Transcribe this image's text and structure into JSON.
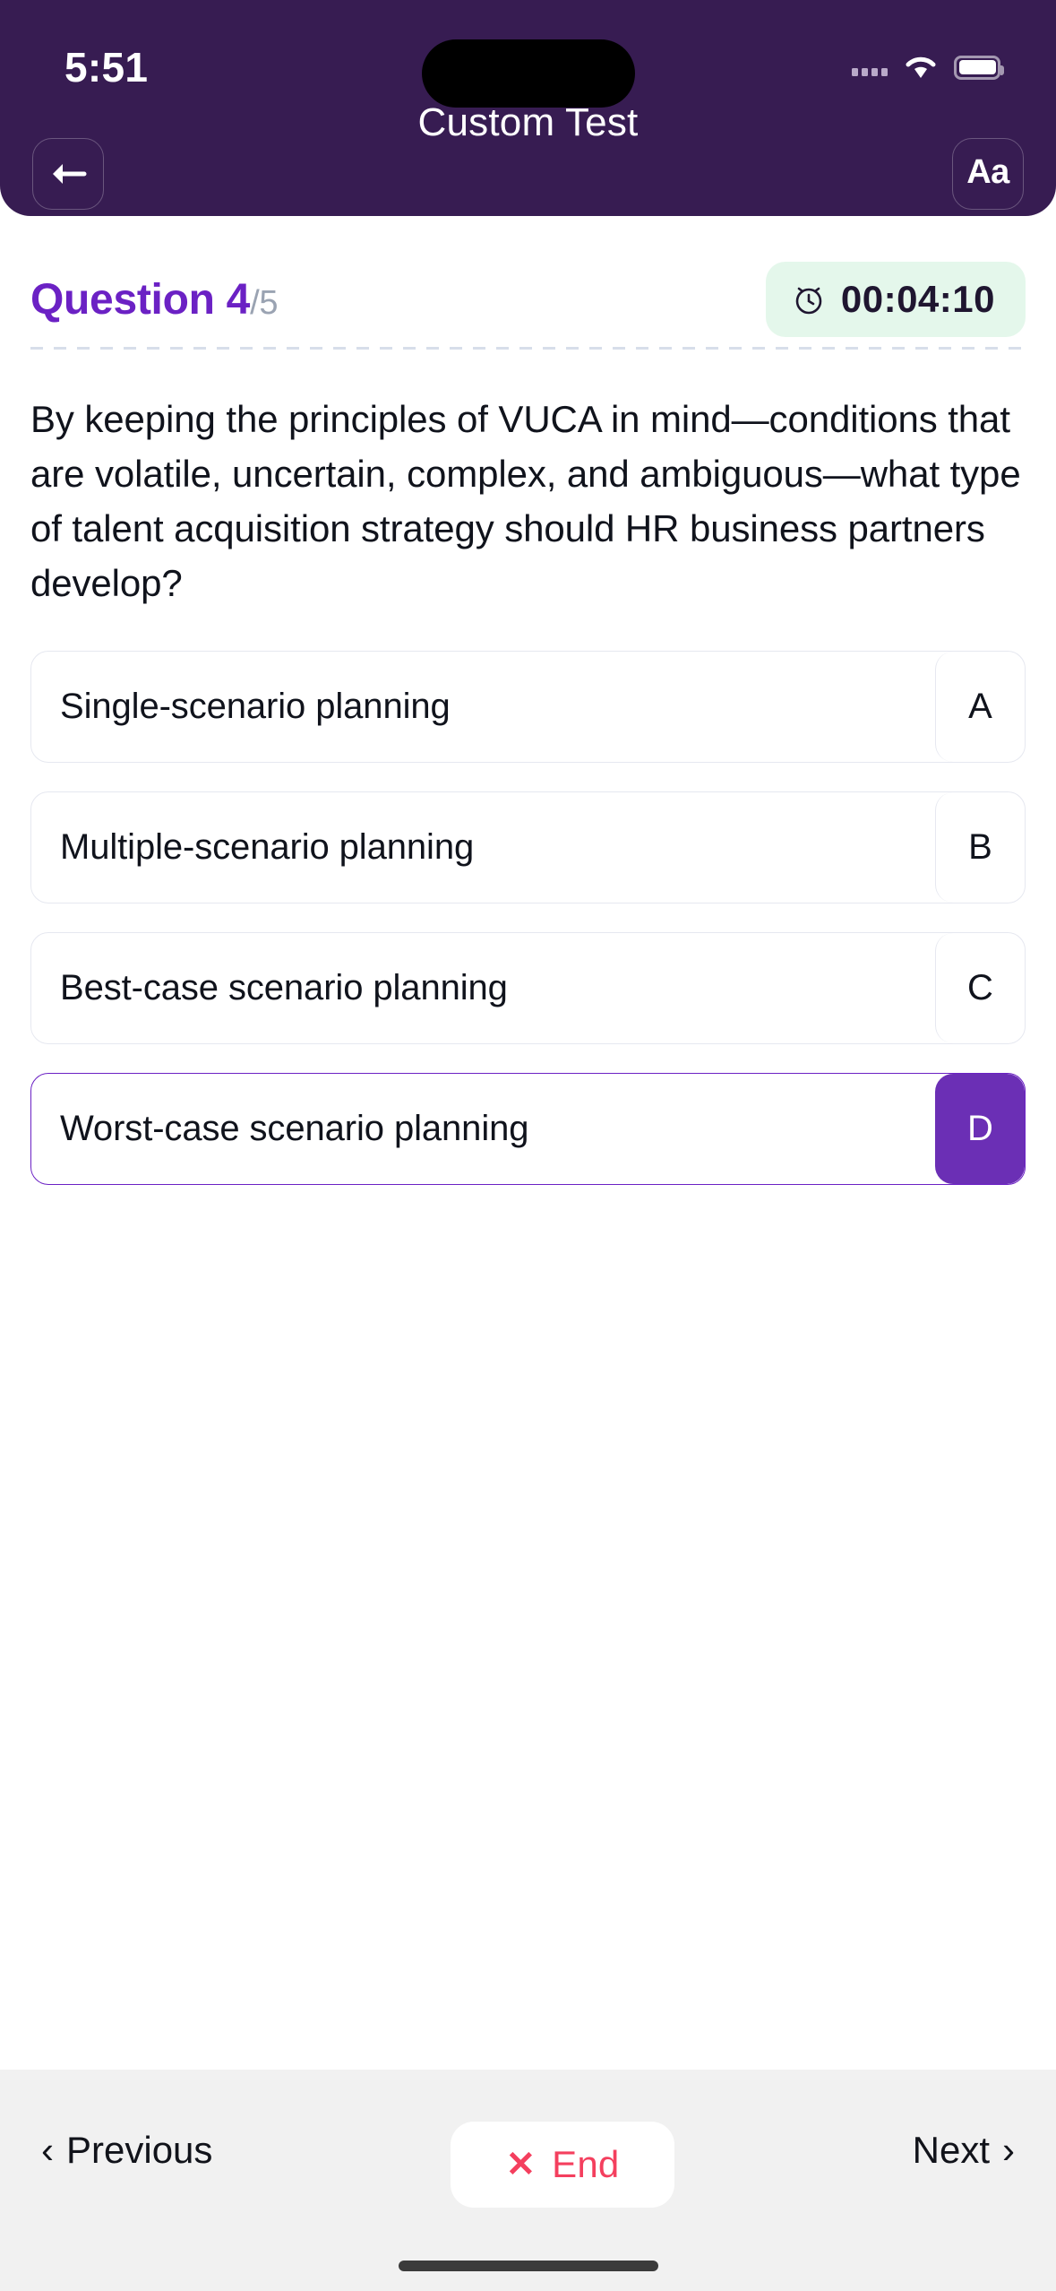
{
  "status_bar": {
    "time": "5:51",
    "signal_icon": "cellular-signal-icon",
    "wifi_icon": "wifi-icon",
    "battery_icon": "battery-icon"
  },
  "header": {
    "title": "Custom Test",
    "back_icon": "back-arrow-icon",
    "font_size_label": "Aa",
    "background_color": "#371C52"
  },
  "question_header": {
    "label": "Question ",
    "current": "4",
    "total": "/5",
    "accent_color": "#6B21C4",
    "timer": {
      "icon": "alarm-clock-icon",
      "value": "00:04:10",
      "background_color": "#E4F7EB"
    }
  },
  "question": {
    "text": "By keeping the principles of VUCA in mind—conditions that are volatile, uncertain, complex, and ambiguous—what type of talent acquisition strategy should HR business partners develop?"
  },
  "options": [
    {
      "letter": "A",
      "text": "Single-scenario planning",
      "selected": false
    },
    {
      "letter": "B",
      "text": "Multiple-scenario planning",
      "selected": false
    },
    {
      "letter": "C",
      "text": "Best-case scenario planning",
      "selected": false
    },
    {
      "letter": "D",
      "text": "Worst-case scenario planning",
      "selected": true
    }
  ],
  "selected_color": "#6B2FB5",
  "bottom_bar": {
    "previous_label": "Previous",
    "previous_icon": "chevron-left-icon",
    "end_label": "End",
    "end_icon": "close-x-icon",
    "end_color": "#F43F5E",
    "next_label": "Next",
    "next_icon": "chevron-right-icon"
  }
}
